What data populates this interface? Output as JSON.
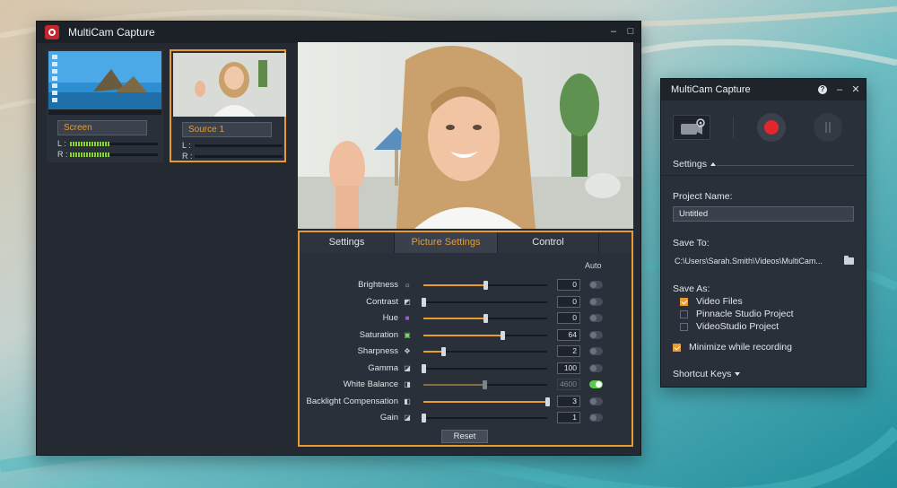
{
  "main_window": {
    "title": "MultiCam Capture",
    "sources": [
      {
        "name": "Screen",
        "meters": [
          {
            "label": "L :",
            "level": 0.45
          },
          {
            "label": "R :",
            "level": 0.45
          }
        ]
      },
      {
        "name": "Source 1",
        "meters": [
          {
            "label": "L :",
            "level": 0.0
          },
          {
            "label": "R :",
            "level": 0.0
          }
        ]
      }
    ],
    "tabs": [
      "Settings",
      "Picture Settings",
      "Control"
    ],
    "selected_tab": "Picture Settings",
    "auto_label": "Auto",
    "picture_settings": [
      {
        "name": "Brightness",
        "icon": "sun-icon",
        "value": "0",
        "level": 0.5,
        "auto": false,
        "enabled": true
      },
      {
        "name": "Contrast",
        "icon": "contrast-icon",
        "value": "0",
        "level": 0.0,
        "auto": false,
        "enabled": true
      },
      {
        "name": "Hue",
        "icon": "hue-icon",
        "value": "0",
        "level": 0.5,
        "auto": false,
        "enabled": true
      },
      {
        "name": "Saturation",
        "icon": "saturation-icon",
        "value": "64",
        "level": 0.64,
        "auto": false,
        "enabled": true
      },
      {
        "name": "Sharpness",
        "icon": "sharpness-icon",
        "value": "2",
        "level": 0.16,
        "auto": false,
        "enabled": true
      },
      {
        "name": "Gamma",
        "icon": "gamma-icon",
        "value": "100",
        "level": 0.0,
        "auto": false,
        "enabled": true
      },
      {
        "name": "White Balance",
        "icon": "white-balance-icon",
        "value": "4600",
        "level": 0.49,
        "auto": true,
        "enabled": false
      },
      {
        "name": "Backlight Compensation",
        "icon": "backlight-icon",
        "value": "3",
        "level": 1.0,
        "auto": false,
        "enabled": true
      },
      {
        "name": "Gain",
        "icon": "gain-icon",
        "value": "1",
        "level": 0.0,
        "auto": false,
        "enabled": true
      }
    ],
    "reset_label": "Reset"
  },
  "widget": {
    "title": "MultiCam Capture",
    "settings_label": "Settings",
    "project_name_label": "Project Name:",
    "project_name_value": "Untitled",
    "save_to_label": "Save To:",
    "save_to_path": "C:\\Users\\Sarah.Smith\\Videos\\MultiCam...",
    "save_as_label": "Save As:",
    "save_as_options": [
      {
        "label": "Video Files",
        "checked": true
      },
      {
        "label": "Pinnacle Studio Project",
        "checked": false
      },
      {
        "label": "VideoStudio Project",
        "checked": false
      }
    ],
    "minimize_label": "Minimize while recording",
    "minimize_checked": true,
    "shortcut_keys_label": "Shortcut Keys"
  },
  "colors": {
    "accent": "#e99b2f",
    "record": "#e3252c",
    "toggle_on": "#5ccb4a",
    "window_bg": "#252a32"
  }
}
